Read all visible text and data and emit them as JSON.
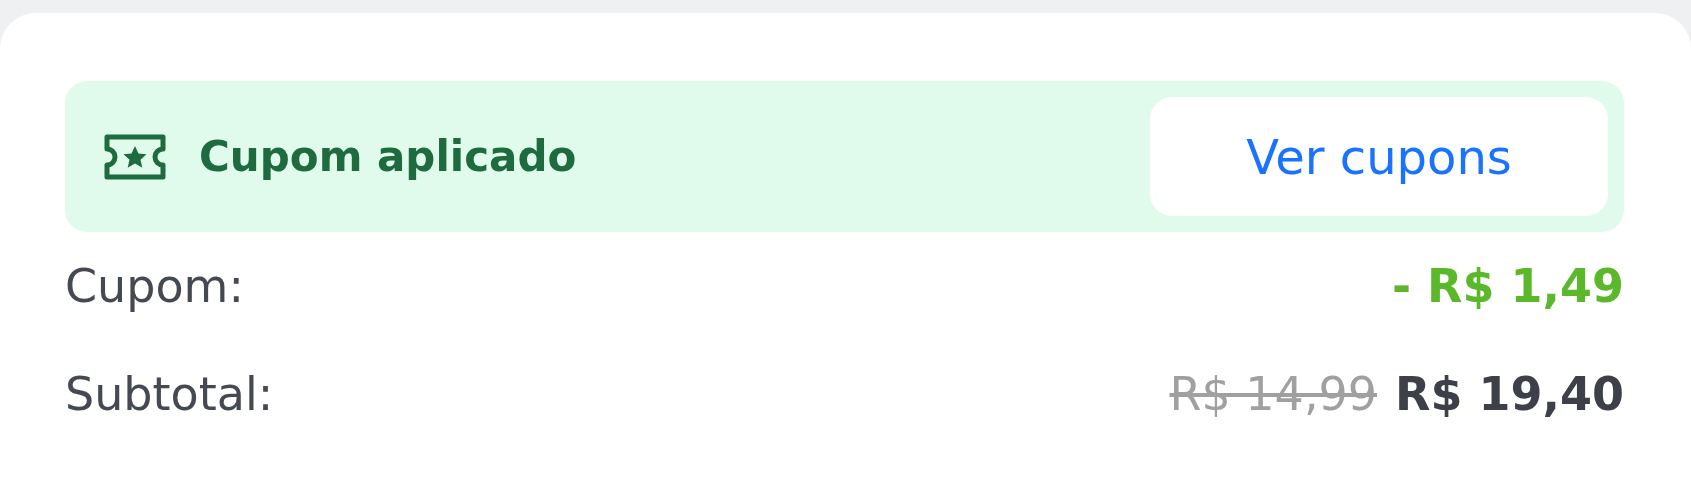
{
  "coupon_banner": {
    "label": "Cupom aplicado",
    "button": "Ver cupons"
  },
  "summary": [
    {
      "kind": "discount",
      "label": "Cupom:",
      "value": "- R$ 1,49"
    },
    {
      "kind": "total",
      "label": "Subtotal:",
      "old_value": "R$ 14,99",
      "value": "R$ 19,40"
    }
  ]
}
